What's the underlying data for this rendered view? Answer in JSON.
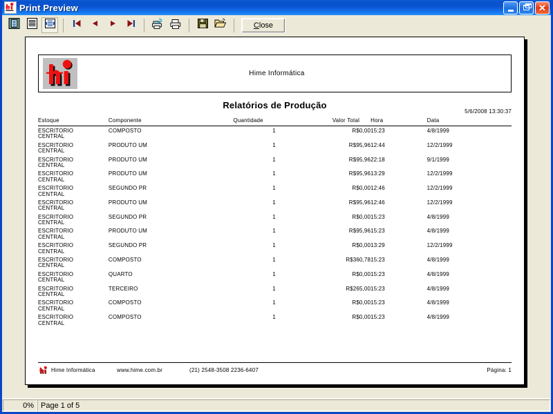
{
  "window": {
    "title": "Print Preview",
    "icon": "app-icon-hi",
    "controls": {
      "minimize": "Minimize",
      "maximize": "Restore",
      "close": "Close"
    }
  },
  "toolbar": {
    "buttons": [
      {
        "name": "view-single-page",
        "icon": "single-page-icon",
        "pressed": false
      },
      {
        "name": "view-continuous",
        "icon": "continuous-page-icon",
        "pressed": false
      },
      {
        "name": "view-zoom",
        "icon": "zoom-page-icon",
        "pressed": true
      },
      {
        "name": "first-page",
        "icon": "first-page-icon",
        "pressed": false
      },
      {
        "name": "previous-page",
        "icon": "previous-page-icon",
        "pressed": false
      },
      {
        "name": "next-page",
        "icon": "next-page-icon",
        "pressed": false
      },
      {
        "name": "last-page",
        "icon": "last-page-icon",
        "pressed": false
      },
      {
        "name": "printer-setup",
        "icon": "printer-setup-icon",
        "pressed": false
      },
      {
        "name": "print",
        "icon": "printer-icon",
        "pressed": false
      },
      {
        "name": "save",
        "icon": "floppy-disk-icon",
        "pressed": false
      },
      {
        "name": "open",
        "icon": "open-folder-icon",
        "pressed": false
      }
    ],
    "close_label": "Close",
    "close_accesskey": "C"
  },
  "report": {
    "company": "Hime Informática",
    "title": "Relatórios de Produção",
    "datetime": "5/6/2008  13:30:37",
    "logo_alt": "hi-logo",
    "columns": [
      "Estoque",
      "Componente",
      "Quantidade",
      "Valor Total",
      "Hora",
      "Data"
    ],
    "rows": [
      {
        "estoque": "ESCRITORIO\nCENTRAL",
        "componente": "COMPOSTO",
        "quantidade": "1",
        "valor": "R$0,00",
        "hora": "15:23",
        "data": "4/8/1999"
      },
      {
        "estoque": "ESCRITORIO\nCENTRAL",
        "componente": "PRODUTO UM",
        "quantidade": "1",
        "valor": "R$95,96",
        "hora": "12:44",
        "data": "12/2/1999"
      },
      {
        "estoque": "ESCRITORIO\nCENTRAL",
        "componente": "PRODUTO UM",
        "quantidade": "1",
        "valor": "R$95,96",
        "hora": "22:18",
        "data": "9/1/1999"
      },
      {
        "estoque": "ESCRITORIO\nCENTRAL",
        "componente": "PRODUTO UM",
        "quantidade": "1",
        "valor": "R$95,96",
        "hora": "13:29",
        "data": "12/2/1999"
      },
      {
        "estoque": "ESCRITORIO\nCENTRAL",
        "componente": "SEGUNDO PR",
        "quantidade": "1",
        "valor": "R$0,00",
        "hora": "12:46",
        "data": "12/2/1999"
      },
      {
        "estoque": "ESCRITORIO\nCENTRAL",
        "componente": "PRODUTO UM",
        "quantidade": "1",
        "valor": "R$95,96",
        "hora": "12:46",
        "data": "12/2/1999"
      },
      {
        "estoque": "ESCRITORIO\nCENTRAL",
        "componente": "SEGUNDO PR",
        "quantidade": "1",
        "valor": "R$0,00",
        "hora": "15:23",
        "data": "4/8/1999"
      },
      {
        "estoque": "ESCRITORIO\nCENTRAL",
        "componente": "PRODUTO UM",
        "quantidade": "1",
        "valor": "R$95,96",
        "hora": "15:23",
        "data": "4/8/1999"
      },
      {
        "estoque": "ESCRITORIO\nCENTRAL",
        "componente": "SEGUNDO PR",
        "quantidade": "1",
        "valor": "R$0,00",
        "hora": "13:29",
        "data": "12/2/1999"
      },
      {
        "estoque": "ESCRITORIO\nCENTRAL",
        "componente": "COMPOSTO",
        "quantidade": "1",
        "valor": "R$360,78",
        "hora": "15:23",
        "data": "4/8/1999"
      },
      {
        "estoque": "ESCRITORIO\nCENTRAL",
        "componente": "QUARTO",
        "quantidade": "1",
        "valor": "R$0,00",
        "hora": "15:23",
        "data": "4/8/1999"
      },
      {
        "estoque": "ESCRITORIO\nCENTRAL",
        "componente": "TERCEIRO",
        "quantidade": "1",
        "valor": "R$265,00",
        "hora": "15:23",
        "data": "4/8/1999"
      },
      {
        "estoque": "ESCRITORIO\nCENTRAL",
        "componente": "COMPOSTO",
        "quantidade": "1",
        "valor": "R$0,00",
        "hora": "15:23",
        "data": "4/8/1999"
      },
      {
        "estoque": "ESCRITORIO\nCENTRAL",
        "componente": "COMPOSTO",
        "quantidade": "1",
        "valor": "R$0,00",
        "hora": "15:23",
        "data": "4/8/1999"
      }
    ],
    "footer": {
      "company": "Hime Informática",
      "website": "www.hime.com.br",
      "phone": "(21) 2548-3508  2236-6407",
      "page_label": "Página: 1"
    }
  },
  "statusbar": {
    "zoom": "0%",
    "page_status": "Page 1 of 5"
  },
  "colors": {
    "titlebar_blue": "#0a53cf",
    "window_face": "#ece9d8",
    "logo_red": "#ee1111",
    "close_red": "#e23b13"
  }
}
